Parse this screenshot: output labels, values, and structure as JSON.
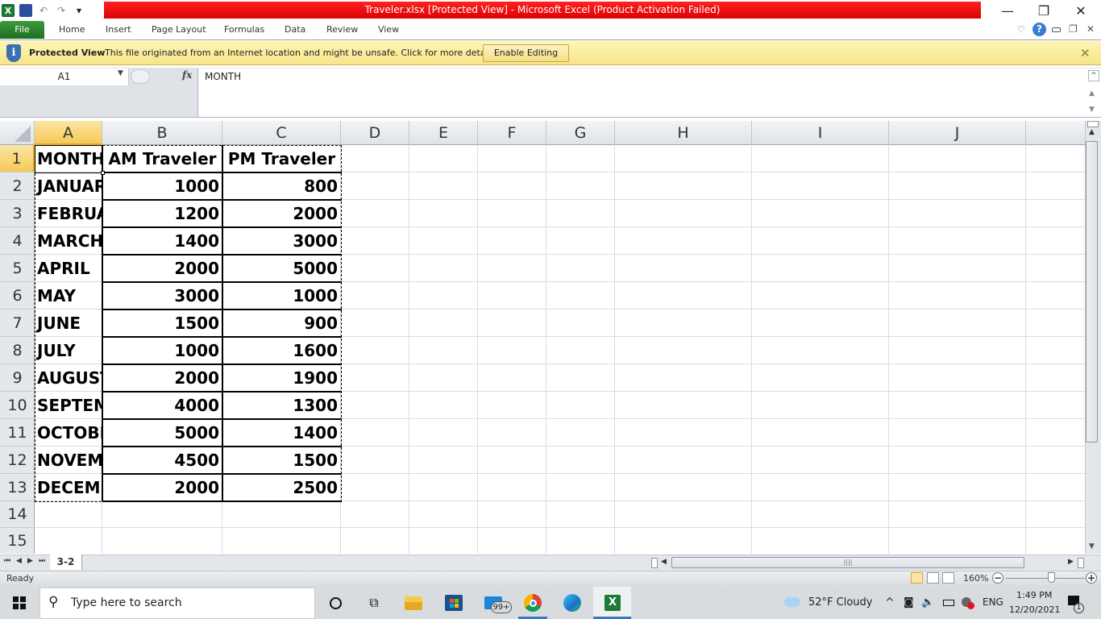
{
  "window": {
    "title": "Traveler.xlsx  [Protected View]  -  Microsoft Excel (Product Activation Failed)",
    "controls": {
      "minimize": "—",
      "restore": "❐",
      "close": "✕"
    }
  },
  "qat": {
    "app_icon": "X",
    "undo": "↶",
    "redo": "↷",
    "customize": "▾"
  },
  "ribbon": {
    "file_label": "File",
    "tabs": [
      "Home",
      "Insert",
      "Page Layout",
      "Formulas",
      "Data",
      "Review",
      "View"
    ],
    "right_icons": [
      "minimize-ribbon-icon",
      "help-icon",
      "window-min-icon",
      "window-restore-icon",
      "window-close-icon"
    ]
  },
  "protected_view": {
    "title": "Protected View",
    "message": "This file originated from an Internet location and might be unsafe. Click for more details.",
    "button": "Enable Editing",
    "close": "✕"
  },
  "formula_bar": {
    "name_box": "A1",
    "fx_label": "fx",
    "content": "MONTH"
  },
  "columns": [
    "A",
    "B",
    "C",
    "D",
    "E",
    "F",
    "G",
    "H",
    "I",
    "J"
  ],
  "rows": [
    "1",
    "2",
    "3",
    "4",
    "5",
    "6",
    "7",
    "8",
    "9",
    "10",
    "11",
    "12",
    "13",
    "14",
    "15"
  ],
  "table": {
    "headers": [
      "MONTH",
      "AM Traveler",
      "PM Traveler"
    ],
    "rows": [
      {
        "month": "JANUARY",
        "am": "1000",
        "pm": "800"
      },
      {
        "month": "FEBRUARY",
        "am": "1200",
        "pm": "2000"
      },
      {
        "month": "MARCH",
        "am": "1400",
        "pm": "3000"
      },
      {
        "month": "APRIL",
        "am": "2000",
        "pm": "5000"
      },
      {
        "month": "MAY",
        "am": "3000",
        "pm": "1000"
      },
      {
        "month": "JUNE",
        "am": "1500",
        "pm": "900"
      },
      {
        "month": "JULY",
        "am": "1000",
        "pm": "1600"
      },
      {
        "month": "AUGUST",
        "am": "2000",
        "pm": "1900"
      },
      {
        "month": "SEPTEMBER",
        "am": "4000",
        "pm": "1300"
      },
      {
        "month": "OCTOBER",
        "am": "5000",
        "pm": "1400"
      },
      {
        "month": "NOVEMBER",
        "am": "4500",
        "pm": "1500"
      },
      {
        "month": "DECEMBER",
        "am": "2000",
        "pm": "2500"
      }
    ]
  },
  "sheet_tabs": {
    "nav": [
      "⏮",
      "◀",
      "▶",
      "⏭"
    ],
    "active": "3-2"
  },
  "status": {
    "mode": "Ready",
    "zoom": "160%",
    "zoom_minus": "−",
    "zoom_plus": "+"
  },
  "taskbar": {
    "search_placeholder": "Type here to search",
    "mail_badge": "99+",
    "weather": "52°F  Cloudy",
    "language": "ENG",
    "time": "1:49 PM",
    "date": "12/20/2021",
    "notifications": "1"
  },
  "colors": {
    "title_red": "#e00000",
    "excel_green": "#1f6e1f",
    "selection_gold": "#f5c957",
    "protected_yellow": "#f9ea97"
  }
}
